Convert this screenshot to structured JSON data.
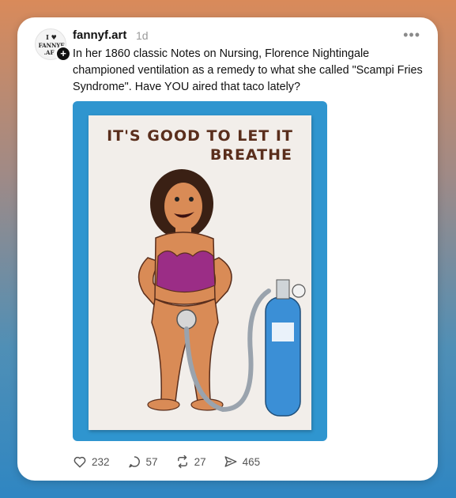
{
  "post": {
    "username": "fannyf.art",
    "time": "1d",
    "more_label": "•••",
    "text": "In her 1860 classic Notes on Nursing, Florence Nightingale championed ventilation as a remedy to what she called \"Scampi Fries Syndrome\". Have YOU aired that taco lately?",
    "avatar_text": [
      "I ♥",
      "FANNYF",
      ".AF"
    ],
    "follow_symbol": "+"
  },
  "artwork": {
    "title_line1": "IT'S GOOD TO LET IT",
    "title_line2": "BREATHE"
  },
  "actions": {
    "likes": "232",
    "replies": "57",
    "reposts": "27",
    "shares": "465"
  },
  "colors": {
    "frame_blue": "#2f95cf",
    "paper": "#f2eeea",
    "title_brown": "#5a2e1c",
    "tank_blue": "#3b8fd6",
    "top_magenta": "#9b2d86"
  }
}
